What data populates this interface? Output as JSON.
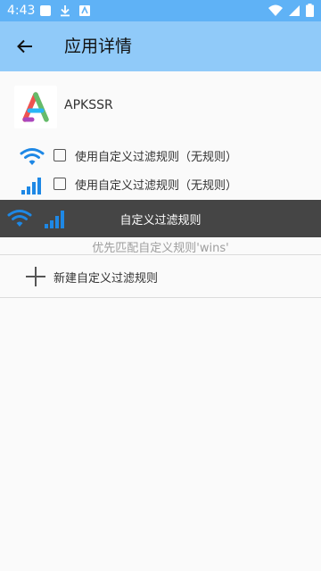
{
  "status_bar": {
    "time": "4:43",
    "icons_left": [
      "notification-square-icon",
      "download-icon",
      "app-notification-icon"
    ],
    "icons_right": [
      "wifi-icon",
      "signal-icon",
      "battery-icon"
    ]
  },
  "toolbar": {
    "title": "应用详情",
    "back_icon": "arrow-back-icon"
  },
  "app": {
    "name": "APKSSR",
    "icon": "apkssr-logo-icon"
  },
  "rules": [
    {
      "icon": "wifi-icon",
      "label": "使用自定义过滤规则（无规则）",
      "checked": false
    },
    {
      "icon": "cellular-icon",
      "label": "使用自定义过滤规则（无规则）",
      "checked": false
    }
  ],
  "overlay_bar": {
    "title": "自定义过滤规则",
    "icons": [
      "wifi-icon",
      "cellular-icon"
    ]
  },
  "priority_text": "优先匹配自定义规则'wins'",
  "new_rule": {
    "label": "新建自定义过滤规则",
    "icon": "plus-icon"
  },
  "colors": {
    "status_bar": "#5fb2f6",
    "toolbar": "#90caf9",
    "accent": "#1e88e5",
    "overlay_bar": "#454545"
  }
}
